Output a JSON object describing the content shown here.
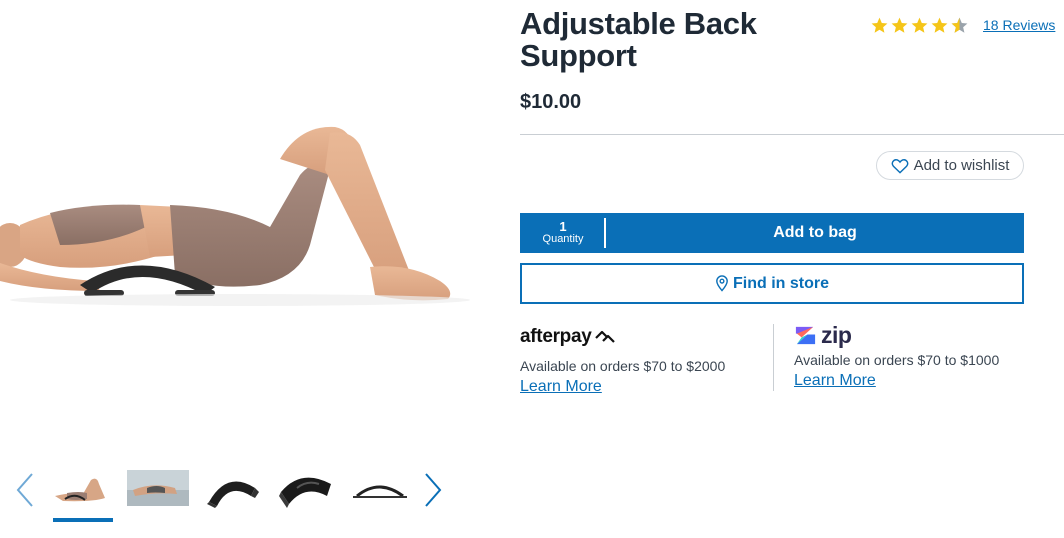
{
  "product": {
    "title": "Adjustable Back Support",
    "price": "$10.00",
    "rating": 4.5,
    "reviews_label": "18 Reviews"
  },
  "actions": {
    "wishlist_label": "Add to wishlist",
    "quantity_value": "1",
    "quantity_label": "Quantity",
    "add_to_bag_label": "Add to bag",
    "find_in_store_label": "Find in store"
  },
  "payments": {
    "afterpay": {
      "logo_text": "afterpay",
      "description": "Available on orders $70 to $2000",
      "link": "Learn More"
    },
    "zip": {
      "logo_text": "zip",
      "description": "Available on orders $70 to $1000",
      "link": "Learn More"
    }
  },
  "gallery": {
    "thumbnail_count": 5,
    "active_index": 0
  },
  "colors": {
    "brand_blue": "#0a6fb7",
    "star_gold": "#f5c518",
    "text_dark": "#1f2a36"
  },
  "icons": {
    "wishlist": "heart-icon",
    "store": "map-pin-icon",
    "prev": "chevron-left-icon",
    "next": "chevron-right-icon"
  }
}
